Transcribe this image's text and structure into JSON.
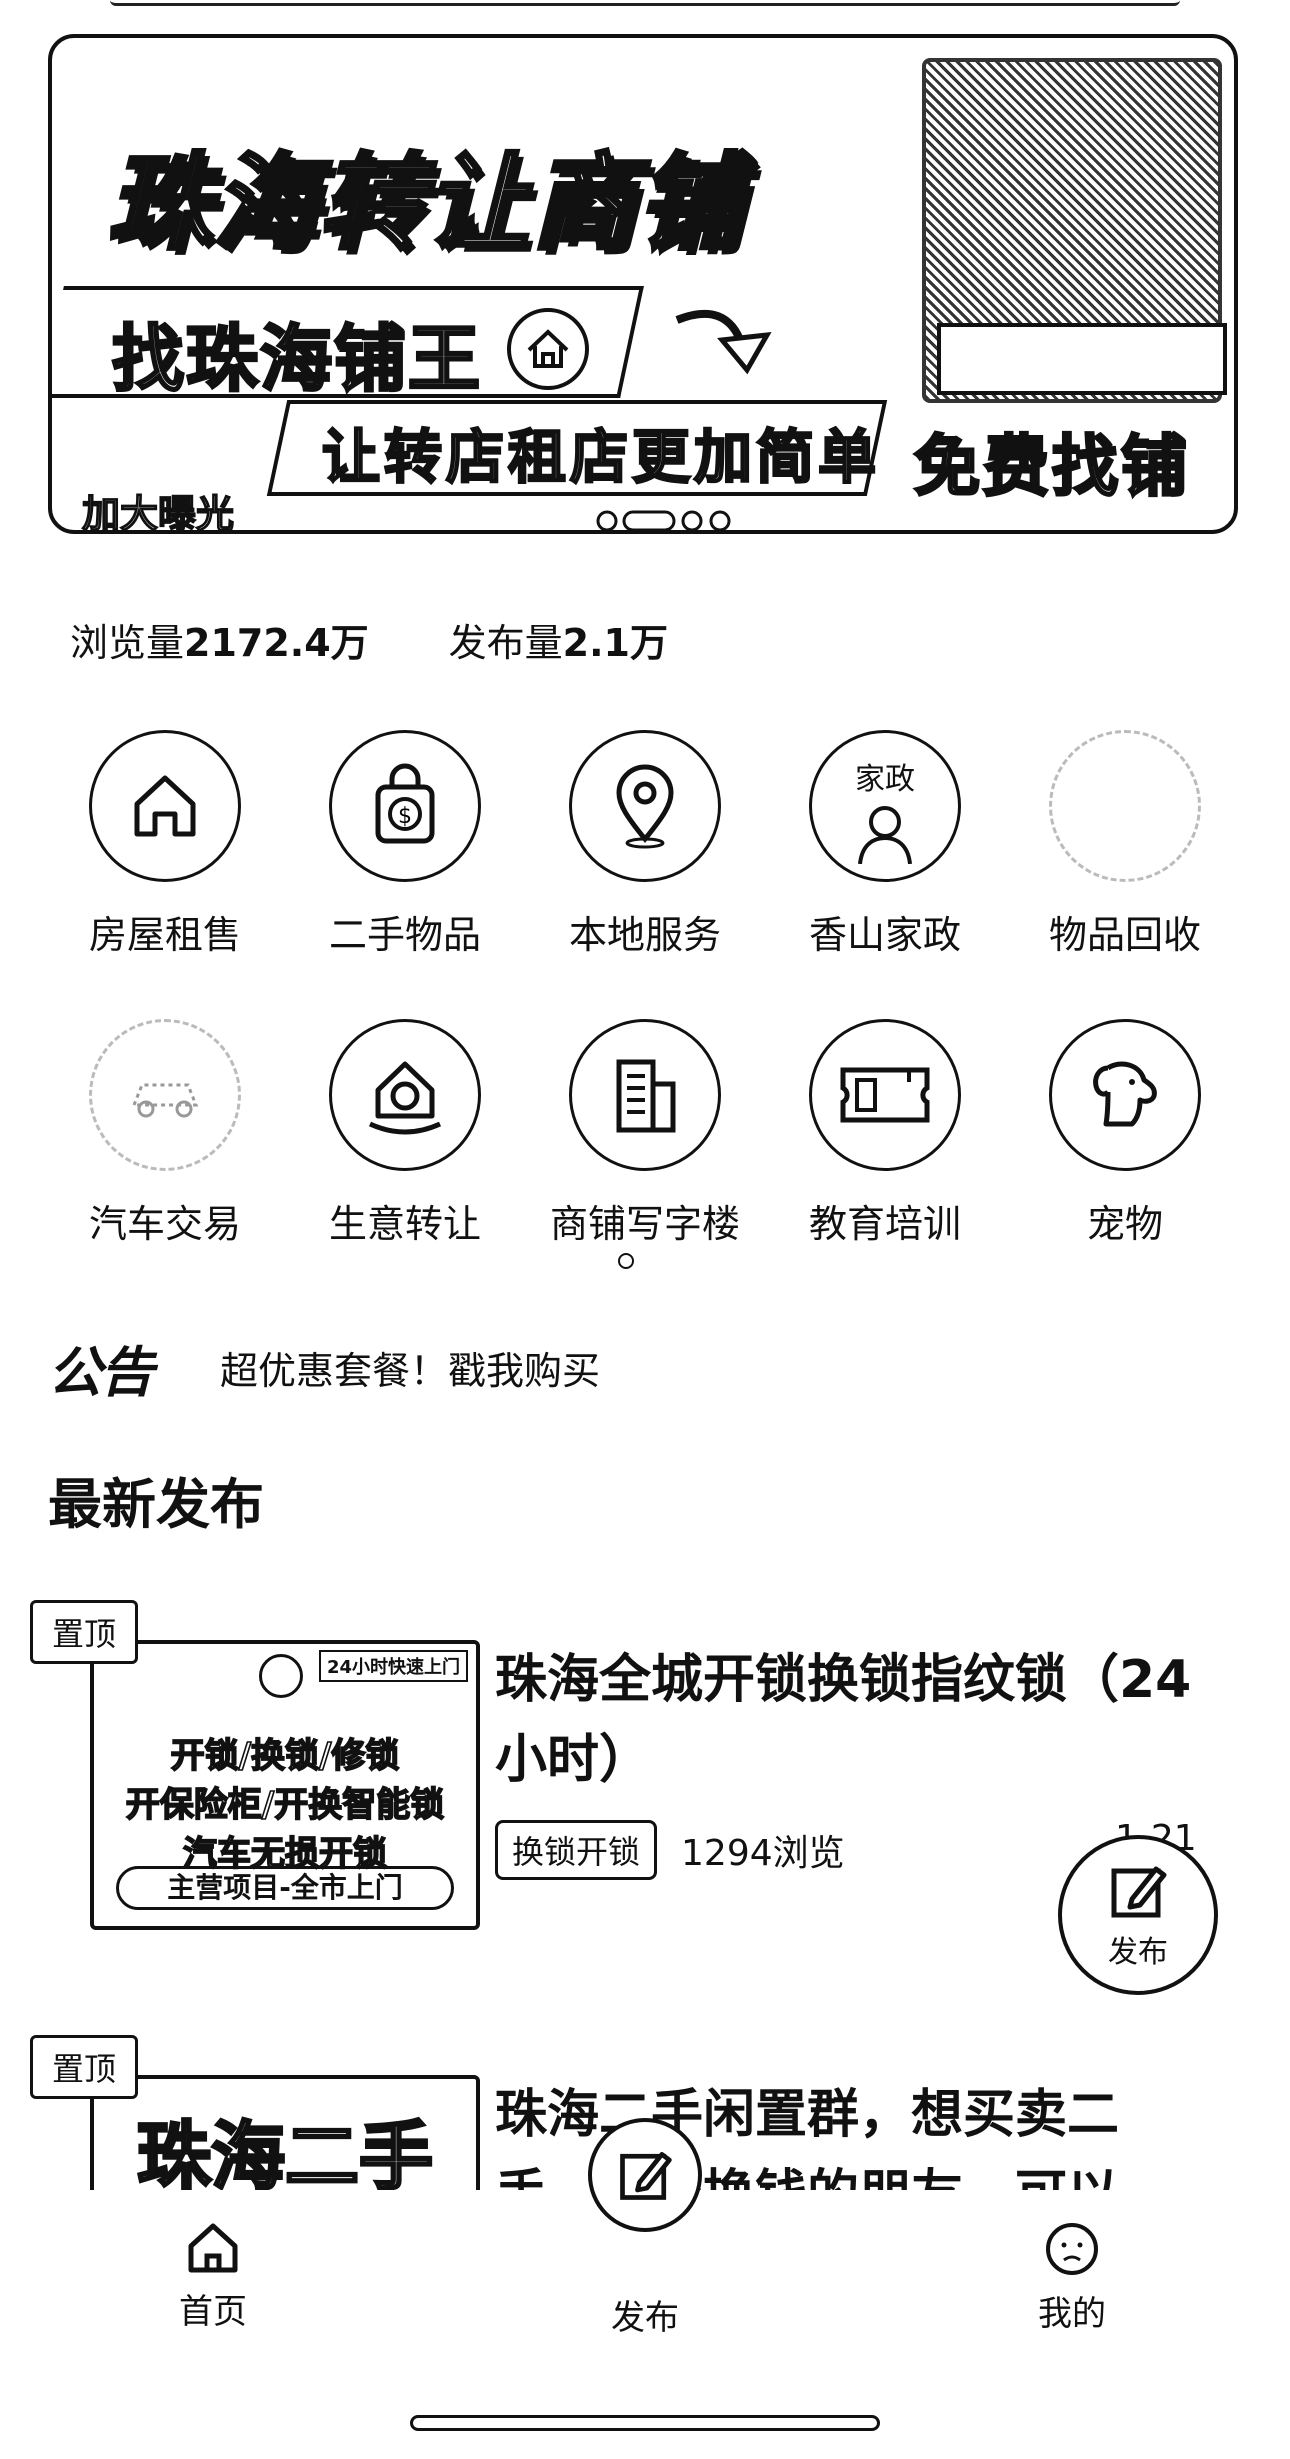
{
  "banner": {
    "title": "珠海转让商铺",
    "tag1": "找珠海铺王",
    "tag2": "让转店租店更加简单",
    "corner": "加大曝光",
    "cta": "免费找铺"
  },
  "stats": {
    "views_label": "浏览量",
    "views_value": "2172.4万",
    "posts_label": "发布量",
    "posts_value": "2.1万"
  },
  "categories": [
    {
      "label": "房屋租售",
      "icon": "house-icon"
    },
    {
      "label": "二手物品",
      "icon": "shopping-bag-icon"
    },
    {
      "label": "本地服务",
      "icon": "location-pin-icon"
    },
    {
      "label": "香山家政",
      "icon": "housekeeping-icon",
      "icon_text": "家政"
    },
    {
      "label": "物品回收",
      "icon": "recycle-icon"
    },
    {
      "label": "汽车交易",
      "icon": "car-icon"
    },
    {
      "label": "生意转让",
      "icon": "business-transfer-icon"
    },
    {
      "label": "商铺写字楼",
      "icon": "office-building-icon"
    },
    {
      "label": "教育培训",
      "icon": "ticket-icon"
    },
    {
      "label": "宠物",
      "icon": "dog-icon"
    }
  ],
  "notice": {
    "tag": "公告",
    "text": "超优惠套餐！戳我购买"
  },
  "section_title": "最新发布",
  "posts": [
    {
      "badge": "置顶",
      "thumb_top": "24小时快速上门",
      "thumb_lines": [
        "开锁/换锁/修锁",
        "开保险柜/开换智能锁",
        "汽车无损开锁"
      ],
      "thumb_cta": "主营项目-全市上门",
      "title": "珠海全城开锁换锁指纹锁（24小时）",
      "tag": "换锁开锁",
      "views": "1294浏览",
      "date": "1-21"
    },
    {
      "badge": "置顶",
      "thumb_lines": [
        "珠海二手"
      ],
      "title": "珠海二手闲置群，想买卖二手、省钱换钱的朋友，可以"
    }
  ],
  "fab": {
    "label": "发布"
  },
  "tabbar": {
    "home": "首页",
    "publish": "发布",
    "mine": "我的"
  }
}
